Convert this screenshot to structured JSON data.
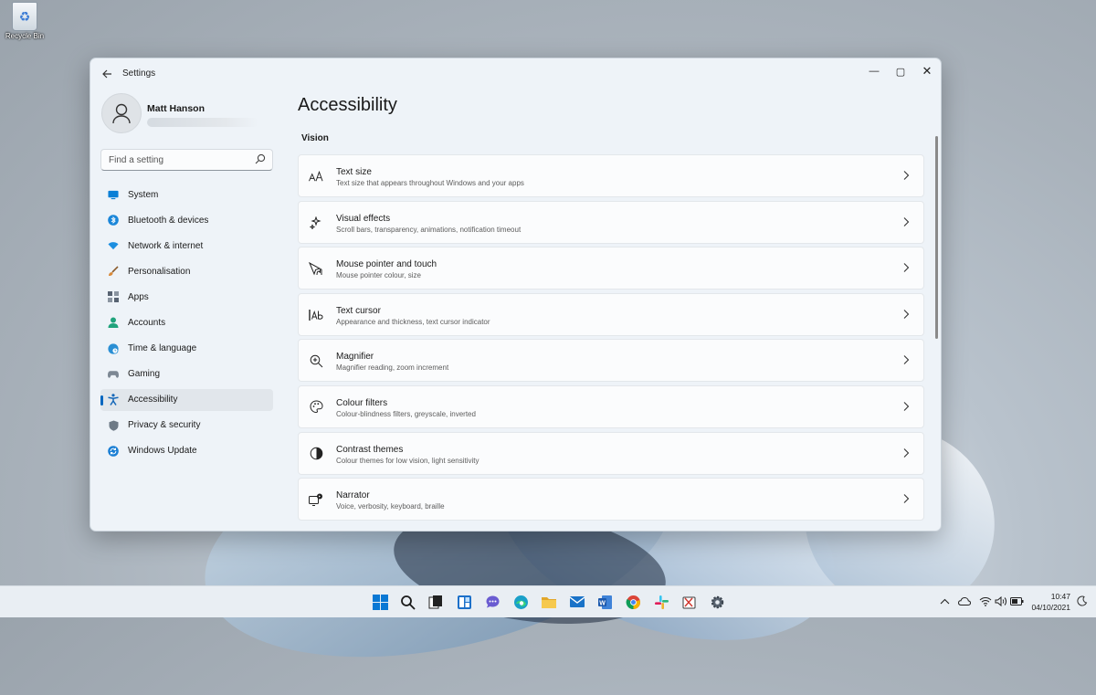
{
  "desktop": {
    "recycle_bin_label": "Recycle Bin"
  },
  "window": {
    "title": "Settings",
    "controls": {
      "minimize": "—",
      "maximize": "▢",
      "close": "✕"
    }
  },
  "profile": {
    "name": "Matt Hanson"
  },
  "search": {
    "placeholder": "Find a setting"
  },
  "sidebar": {
    "items": [
      {
        "label": "System",
        "icon": "monitor-icon",
        "color": "#0a7fd6"
      },
      {
        "label": "Bluetooth & devices",
        "icon": "bluetooth-icon",
        "color": "#1a86d9"
      },
      {
        "label": "Network & internet",
        "icon": "wifi-icon",
        "color": "#1c8ee0"
      },
      {
        "label": "Personalisation",
        "icon": "brush-icon",
        "color": "#d98a3a"
      },
      {
        "label": "Apps",
        "icon": "apps-icon",
        "color": "#586372"
      },
      {
        "label": "Accounts",
        "icon": "person-icon",
        "color": "#20a37c"
      },
      {
        "label": "Time & language",
        "icon": "globe-clock-icon",
        "color": "#2a8fd4"
      },
      {
        "label": "Gaming",
        "icon": "gamepad-icon",
        "color": "#7d8894"
      },
      {
        "label": "Accessibility",
        "icon": "accessibility-icon",
        "color": "#1467b8",
        "active": true
      },
      {
        "label": "Privacy & security",
        "icon": "shield-icon",
        "color": "#6e7a86"
      },
      {
        "label": "Windows Update",
        "icon": "update-icon",
        "color": "#1b7fd4"
      }
    ]
  },
  "main": {
    "title": "Accessibility",
    "section": "Vision",
    "cards": [
      {
        "title": "Text size",
        "desc": "Text size that appears throughout Windows and your apps",
        "icon": "text-size-icon"
      },
      {
        "title": "Visual effects",
        "desc": "Scroll bars, transparency, animations, notification timeout",
        "icon": "sparkle-icon"
      },
      {
        "title": "Mouse pointer and touch",
        "desc": "Mouse pointer colour, size",
        "icon": "pointer-touch-icon"
      },
      {
        "title": "Text cursor",
        "desc": "Appearance and thickness, text cursor indicator",
        "icon": "text-cursor-icon"
      },
      {
        "title": "Magnifier",
        "desc": "Magnifier reading, zoom increment",
        "icon": "magnifier-icon"
      },
      {
        "title": "Colour filters",
        "desc": "Colour-blindness filters, greyscale, inverted",
        "icon": "palette-icon"
      },
      {
        "title": "Contrast themes",
        "desc": "Colour themes for low vision, light sensitivity",
        "icon": "contrast-icon"
      },
      {
        "title": "Narrator",
        "desc": "Voice, verbosity, keyboard, braille",
        "icon": "narrator-icon"
      }
    ]
  },
  "taskbar": {
    "apps": [
      "windows-start-icon",
      "search-icon",
      "task-view-icon",
      "widgets-icon",
      "teams-chat-icon",
      "edge-icon",
      "file-explorer-icon",
      "mail-icon",
      "word-icon",
      "chrome-icon",
      "slack-icon",
      "snipping-tool-icon",
      "settings-icon"
    ],
    "tray": [
      "chevron-up-icon",
      "onedrive-icon",
      "wifi-icon",
      "volume-icon",
      "battery-icon"
    ],
    "time": "10:47",
    "date": "04/10/2021"
  }
}
